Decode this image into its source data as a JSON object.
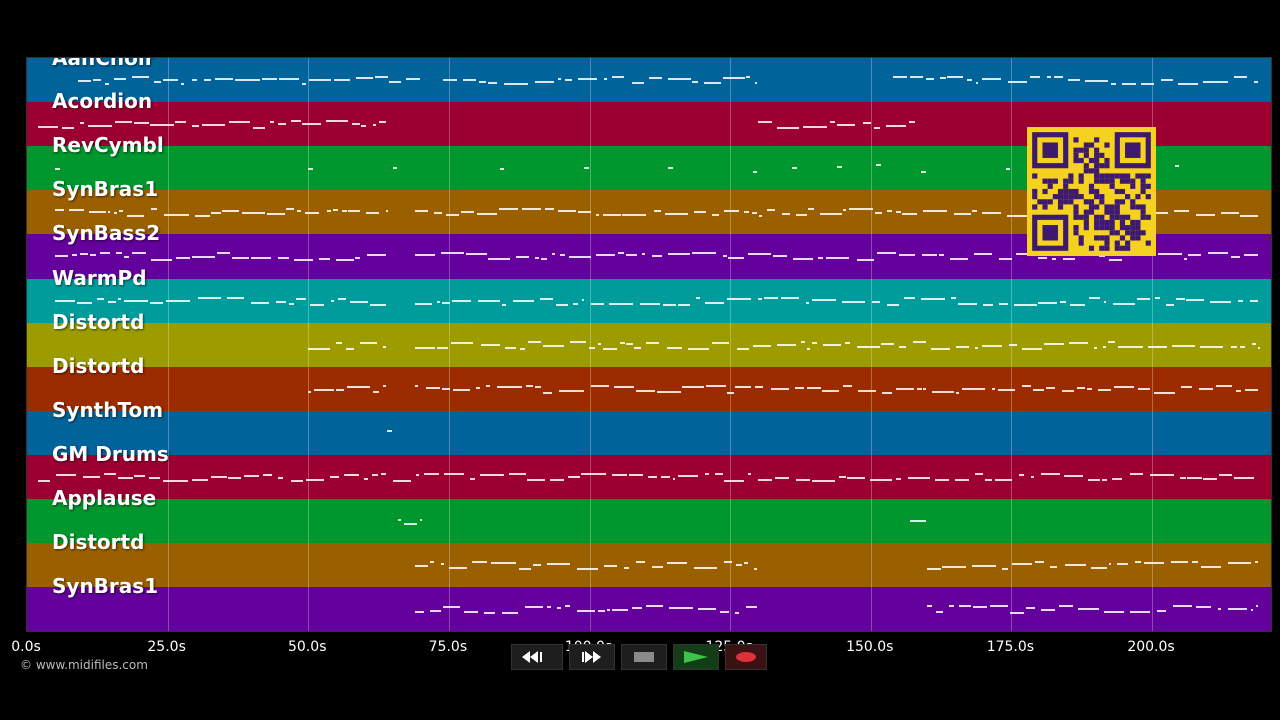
{
  "tracks": [
    {
      "name": "AahChoir",
      "color": "#00639a"
    },
    {
      "name": "Acordion",
      "color": "#9b0030"
    },
    {
      "name": "RevCymbl",
      "color": "#00972e"
    },
    {
      "name": "SynBras1",
      "color": "#9a6000"
    },
    {
      "name": "SynBass2",
      "color": "#64009b"
    },
    {
      "name": "WarmPd",
      "color": "#009c9c"
    },
    {
      "name": "Distortd",
      "color": "#9c9c00"
    },
    {
      "name": "Distortd",
      "color": "#9b2c00"
    },
    {
      "name": "SynthTom",
      "color": "#00639a"
    },
    {
      "name": "GM Drums",
      "color": "#9b0030"
    },
    {
      "name": "Applause",
      "color": "#00972e"
    },
    {
      "name": "Distortd",
      "color": "#9a6000"
    },
    {
      "name": "SynBras1",
      "color": "#64009b"
    }
  ],
  "axis": {
    "unit": "s",
    "ticks": [
      {
        "value": 0,
        "label": "0.0s"
      },
      {
        "value": 25,
        "label": "25.0s"
      },
      {
        "value": 50,
        "label": "50.0s"
      },
      {
        "value": 75,
        "label": "75.0s"
      },
      {
        "value": 100,
        "label": "100.0s"
      },
      {
        "value": 125,
        "label": "125.0s"
      },
      {
        "value": 150,
        "label": "150.0s"
      },
      {
        "value": 175,
        "label": "175.0s"
      },
      {
        "value": 200,
        "label": "200.0s"
      }
    ],
    "max": 221
  },
  "credit": "© www.midifiles.com",
  "transport": {
    "rewind": "rewind-icon",
    "fast_forward": "fast-forward-icon",
    "stop": "stop-icon",
    "play": "play-icon",
    "record": "record-icon",
    "record_color": "#e0303a",
    "play_color": "#3ec24a"
  },
  "qr_code": "qr-code"
}
